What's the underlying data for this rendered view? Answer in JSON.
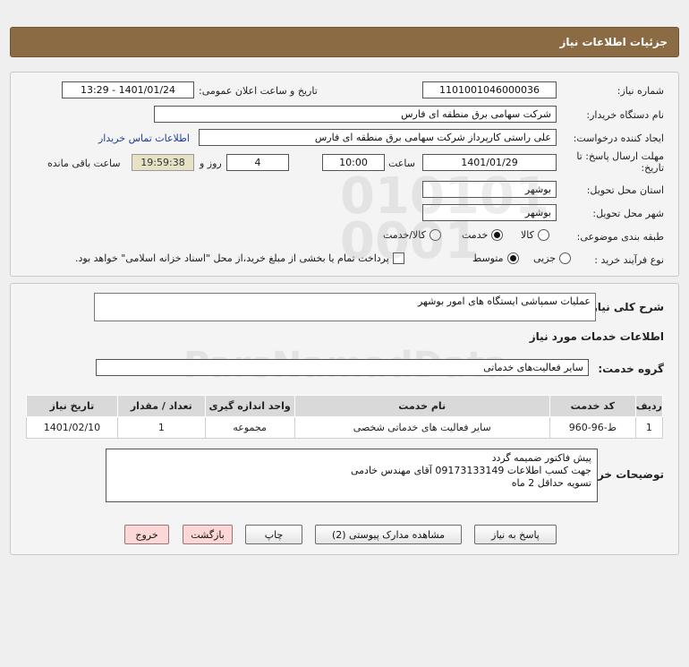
{
  "header": {
    "title": "جزئیات اطلاعات نیاز"
  },
  "form": {
    "need_number_label": "شماره نیاز:",
    "need_number": "1101001046000036",
    "announce_label": "تاریخ و ساعت اعلان عمومی:",
    "announce_value": "1401/01/24 - 13:29",
    "buyer_org_label": "نام دستگاه خریدار:",
    "buyer_org": "شرکت سهامی برق منطقه ای فارس",
    "creator_label": "ایجاد کننده درخواست:",
    "creator": "علی راستی کارپرداز شرکت سهامی برق منطقه ای فارس",
    "contact_link": "اطلاعات تماس خریدار",
    "deadline_label_1": "مهلت ارسال پاسخ: تا",
    "deadline_label_2": "تاریخ:",
    "deadline_date": "1401/01/29",
    "time_label": "ساعت",
    "deadline_time": "10:00",
    "days_value": "4",
    "days_label": "روز و",
    "remaining_time": "19:59:38",
    "remaining_label": "ساعت باقی مانده",
    "province_label": "استان محل تحویل:",
    "province": "بوشهر",
    "city_label": "شهر محل تحویل:",
    "city": "بوشهر",
    "category_label": "طبقه بندی موضوعی:",
    "category_options": [
      "کالا",
      "خدمت",
      "کالا/خدمت"
    ],
    "category_selected": "خدمت",
    "process_label": "نوع فرآیند خرید :",
    "process_options": [
      "جزیی",
      "متوسط"
    ],
    "process_selected": "متوسط",
    "payment_note": "پرداخت تمام یا بخشی از مبلغ خرید،از محل \"اسناد خزانه اسلامی\" خواهد بود."
  },
  "summary": {
    "label": "شرح کلی نیاز:",
    "value": "عملیات سمپاشی ایستگاه های امور بوشهر",
    "services_title": "اطلاعات خدمات مورد نیاز",
    "group_label": "گروه خدمت:",
    "group_value": "سایر فعالیت‌های خدماتی"
  },
  "table": {
    "headers": [
      "ردیف",
      "کد خدمت",
      "نام خدمت",
      "واحد اندازه گیری",
      "تعداد / مقدار",
      "تاریخ نیاز"
    ],
    "rows": [
      [
        "1",
        "ط-96-960",
        "سایر فعالیت های خدماتی شخصی",
        "مجموعه",
        "1",
        "1401/02/10"
      ]
    ]
  },
  "notes": {
    "label": "توضیحات خریدار:",
    "lines": [
      "پیش فاکتور ضمیمه گردد",
      "جهت کسب اطلاعات 09173133149 آقای مهندس خادمی",
      "تسویه حداقل 2 ماه"
    ]
  },
  "buttons": {
    "reply": "پاسخ به نیاز",
    "attachments": "مشاهده مدارک پیوستی (2)",
    "print": "چاپ",
    "back": "بازگشت",
    "exit": "خروج"
  },
  "colors": {
    "header_bg": "#8b6b44",
    "timer_bg": "#e7e2c6",
    "link": "#1f3e96",
    "exit_btn_bg": "#fbd7d7"
  }
}
